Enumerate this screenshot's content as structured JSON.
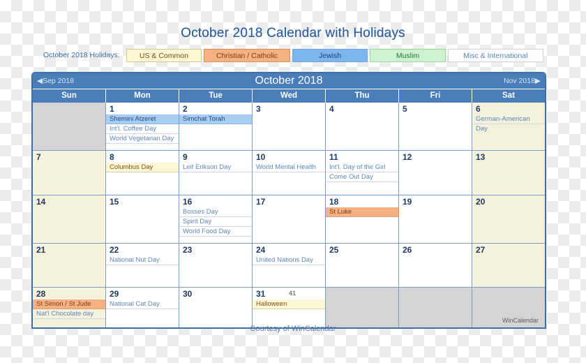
{
  "page": {
    "title": "October 2018 Calendar with Holidays",
    "footer": "Courtesy of WinCalendar",
    "watermark": "WinCalendar"
  },
  "legend": {
    "label": "October 2018 Holidays:",
    "chips": [
      {
        "label": "US & Common",
        "key": "us",
        "bg": "#fbf8d6",
        "fg": "#7b4b14"
      },
      {
        "label": "Christian / Catholic",
        "key": "christian",
        "bg": "#f6b183",
        "fg": "#7b3d14"
      },
      {
        "label": "Jewish",
        "key": "jewish",
        "bg": "#7db5f0",
        "fg": "#15427c"
      },
      {
        "label": "Muslim",
        "key": "muslim",
        "bg": "#cdf2cd",
        "fg": "#1d7a3e"
      },
      {
        "label": "Misc & International",
        "key": "misc",
        "bg": "#fdfdfd",
        "fg": "#5b85b8"
      }
    ]
  },
  "calendar": {
    "month_title": "October 2018",
    "prev_month": "◀Sep 2018",
    "next_month": "Nov 2018▶",
    "accent": "#4a7ebb",
    "grid_line": "#7a9ec9",
    "weekend_bg": "#f4f2dc",
    "blank_bg": "#d4d4d4",
    "day_headers": [
      "Sun",
      "Mon",
      "Tue",
      "Wed",
      "Thu",
      "Fri",
      "Sat"
    ],
    "weeks": [
      [
        {
          "day": "",
          "blank": true,
          "weekend": true,
          "events": []
        },
        {
          "day": "1",
          "weekend": false,
          "events": [
            {
              "text": "Shemini Atzeret",
              "cat": "jewish"
            },
            {
              "text": "Int'l. Coffee Day",
              "cat": "misc"
            },
            {
              "text": "World Vegetarian Day",
              "cat": "misc"
            }
          ]
        },
        {
          "day": "2",
          "weekend": false,
          "events": [
            {
              "text": "Simchat Torah",
              "cat": "jewish"
            }
          ]
        },
        {
          "day": "3",
          "weekend": false,
          "events": []
        },
        {
          "day": "4",
          "weekend": false,
          "events": []
        },
        {
          "day": "5",
          "weekend": false,
          "events": []
        },
        {
          "day": "6",
          "weekend": true,
          "events": [
            {
              "text": "German-American",
              "cat": "misc"
            },
            {
              "text": "Day",
              "cat": "misc",
              "nounderline": true
            }
          ]
        }
      ],
      [
        {
          "day": "7",
          "weekend": true,
          "events": []
        },
        {
          "day": "8",
          "weekend": false,
          "events": [
            {
              "text": "Columbus Day",
              "cat": "us"
            }
          ]
        },
        {
          "day": "9",
          "weekend": false,
          "events": [
            {
              "text": "Leif Erikson Day",
              "cat": "misc"
            }
          ]
        },
        {
          "day": "10",
          "weekend": false,
          "events": [
            {
              "text": "World Mental Health",
              "cat": "misc"
            }
          ]
        },
        {
          "day": "11",
          "weekend": false,
          "events": [
            {
              "text": "Int'l. Day of the Girl",
              "cat": "misc"
            },
            {
              "text": "Come Out Day",
              "cat": "misc"
            }
          ]
        },
        {
          "day": "12",
          "weekend": false,
          "events": []
        },
        {
          "day": "13",
          "weekend": true,
          "events": []
        }
      ],
      [
        {
          "day": "14",
          "weekend": true,
          "events": []
        },
        {
          "day": "15",
          "weekend": false,
          "events": []
        },
        {
          "day": "16",
          "weekend": false,
          "events": [
            {
              "text": "Bosses Day",
              "cat": "misc"
            },
            {
              "text": "Spirit Day",
              "cat": "misc"
            },
            {
              "text": "World Food Day",
              "cat": "misc"
            }
          ]
        },
        {
          "day": "17",
          "weekend": false,
          "events": []
        },
        {
          "day": "18",
          "weekend": false,
          "events": [
            {
              "text": "St Luke",
              "cat": "christian"
            }
          ]
        },
        {
          "day": "19",
          "weekend": false,
          "events": []
        },
        {
          "day": "20",
          "weekend": true,
          "events": []
        }
      ],
      [
        {
          "day": "21",
          "weekend": true,
          "events": []
        },
        {
          "day": "22",
          "weekend": false,
          "events": [
            {
              "text": "National Nut Day",
              "cat": "misc"
            }
          ]
        },
        {
          "day": "23",
          "weekend": false,
          "events": []
        },
        {
          "day": "24",
          "weekend": false,
          "events": [
            {
              "text": "United Nations Day",
              "cat": "misc"
            }
          ]
        },
        {
          "day": "25",
          "weekend": false,
          "events": []
        },
        {
          "day": "26",
          "weekend": false,
          "events": []
        },
        {
          "day": "27",
          "weekend": true,
          "events": []
        }
      ],
      [
        {
          "day": "28",
          "weekend": true,
          "events": [
            {
              "text": "St Simon / St Jude",
              "cat": "christian"
            },
            {
              "text": "Nat'l Chocolate day",
              "cat": "misc"
            }
          ]
        },
        {
          "day": "29",
          "weekend": false,
          "events": [
            {
              "text": "National Cat Day",
              "cat": "misc"
            }
          ]
        },
        {
          "day": "30",
          "weekend": false,
          "events": []
        },
        {
          "day": "31",
          "weekend": false,
          "weeknum": "41",
          "events": [
            {
              "text": "Halloween",
              "cat": "us"
            }
          ]
        },
        {
          "day": "",
          "spacer": true,
          "events": []
        },
        {
          "day": "",
          "spacer": true,
          "events": []
        },
        {
          "day": "",
          "spacer": true,
          "watermark": true,
          "events": []
        }
      ]
    ]
  }
}
